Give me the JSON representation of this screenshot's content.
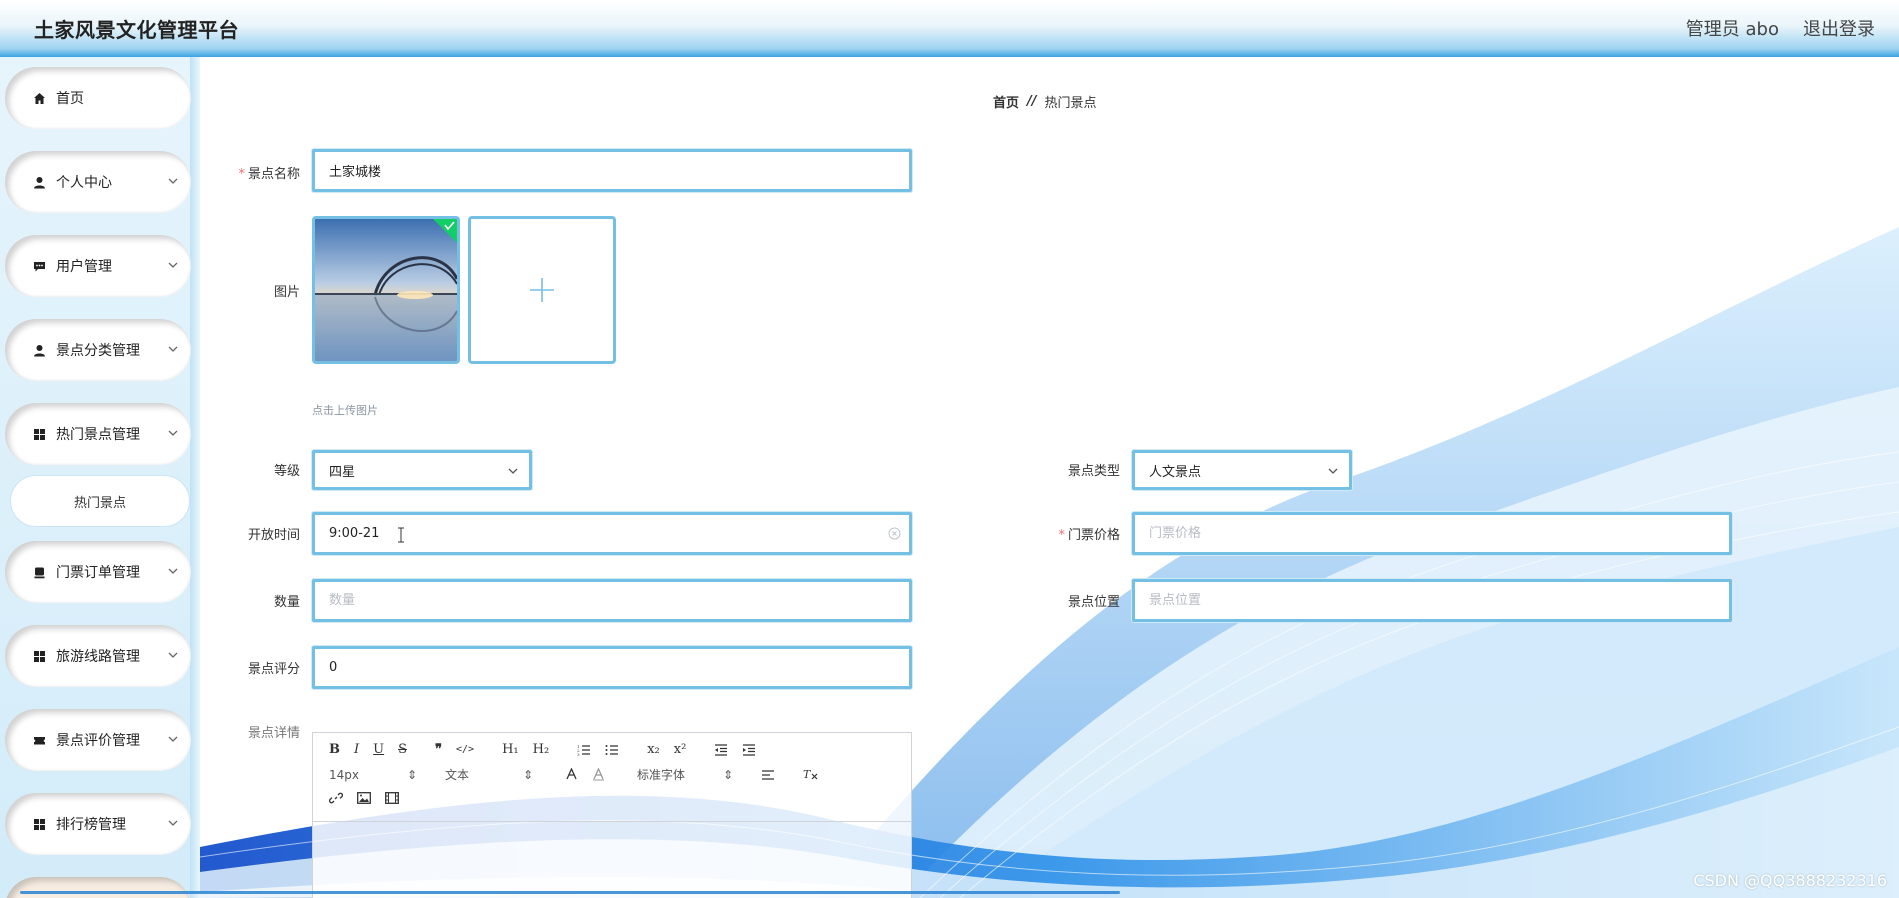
{
  "app": {
    "title": "土家风景文化管理平台",
    "admin_label": "管理员 abo",
    "logout_label": "退出登录"
  },
  "sidebar": {
    "items": [
      {
        "label": "首页",
        "icon": "home-icon"
      },
      {
        "label": "个人中心",
        "icon": "user-icon"
      },
      {
        "label": "用户管理",
        "icon": "chat-icon"
      },
      {
        "label": "景点分类管理",
        "icon": "user-icon"
      },
      {
        "label": "热门景点管理",
        "icon": "grid-icon"
      },
      {
        "label": "门票订单管理",
        "icon": "ticket-icon"
      },
      {
        "label": "旅游线路管理",
        "icon": "grid-icon"
      },
      {
        "label": "景点评价管理",
        "icon": "ticket-icon"
      },
      {
        "label": "排行榜管理",
        "icon": "grid-icon"
      }
    ],
    "submenu": {
      "label": "热门景点"
    }
  },
  "breadcrumb": {
    "home": "首页",
    "separator": "//",
    "current": "热门景点"
  },
  "form": {
    "name": {
      "label": "景点名称",
      "value": "土家城楼"
    },
    "image": {
      "label": "图片",
      "tip": "点击上传图片"
    },
    "grade": {
      "label": "等级",
      "value": "四星"
    },
    "type": {
      "label": "景点类型",
      "value": "人文景点"
    },
    "open_time": {
      "label": "开放时间",
      "value": "9:00-21"
    },
    "price": {
      "label": "门票价格",
      "placeholder": "门票价格"
    },
    "quantity": {
      "label": "数量",
      "placeholder": "数量"
    },
    "location": {
      "label": "景点位置",
      "placeholder": "景点位置"
    },
    "rating": {
      "label": "景点评分",
      "value": "0"
    },
    "detail": {
      "label": "景点详情"
    }
  },
  "editor": {
    "font_size": "14px",
    "text_style": "文本",
    "font_family": "标准字体",
    "buttons": {
      "bold": "B",
      "italic": "I",
      "underline": "U",
      "strike": "S",
      "quote": "❞",
      "code": "</>",
      "h1": "H₁",
      "h2": "H₂",
      "subscript": "x₂",
      "superscript": "x²",
      "clear": "Tx"
    }
  },
  "watermark": "CSDN @QQ3888232316",
  "colors": {
    "accent": "#74c0e4",
    "header": "#3aa3e0",
    "required": "#f56c6c"
  }
}
